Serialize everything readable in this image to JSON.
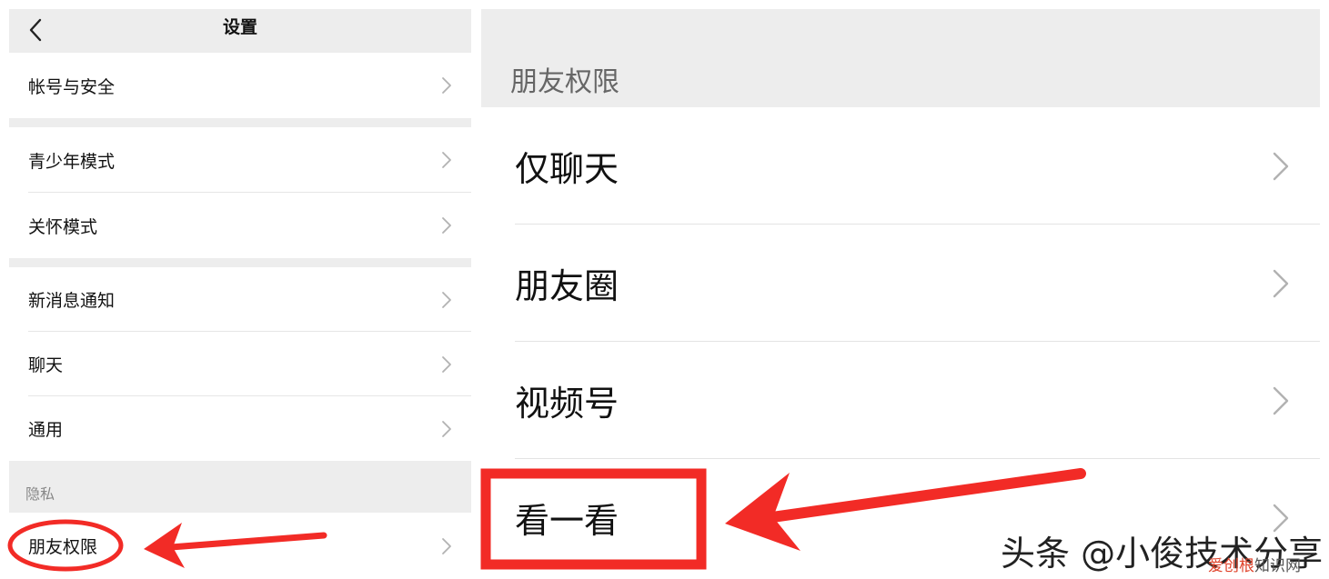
{
  "left_panel": {
    "nav_title": "设置",
    "items": [
      {
        "label": "帐号与安全"
      },
      {
        "label": "青少年模式"
      },
      {
        "label": "关怀模式"
      },
      {
        "label": "新消息通知"
      },
      {
        "label": "聊天"
      },
      {
        "label": "通用"
      }
    ],
    "privacy_header": "隐私",
    "privacy_item": {
      "label": "朋友权限"
    }
  },
  "right_panel": {
    "header": "朋友权限",
    "items": [
      {
        "label": "仅聊天"
      },
      {
        "label": "朋友圈"
      },
      {
        "label": "视频号"
      },
      {
        "label": "看一看"
      }
    ]
  },
  "annotations": {
    "highlight_color": "#f22b26",
    "watermark": "头条 @小俊技术分享",
    "site_mark_part1": "爱创根",
    "site_mark_part2": "知识网"
  },
  "icons": {
    "back": "chevron-left-icon",
    "row_arrow": "chevron-right-icon"
  }
}
